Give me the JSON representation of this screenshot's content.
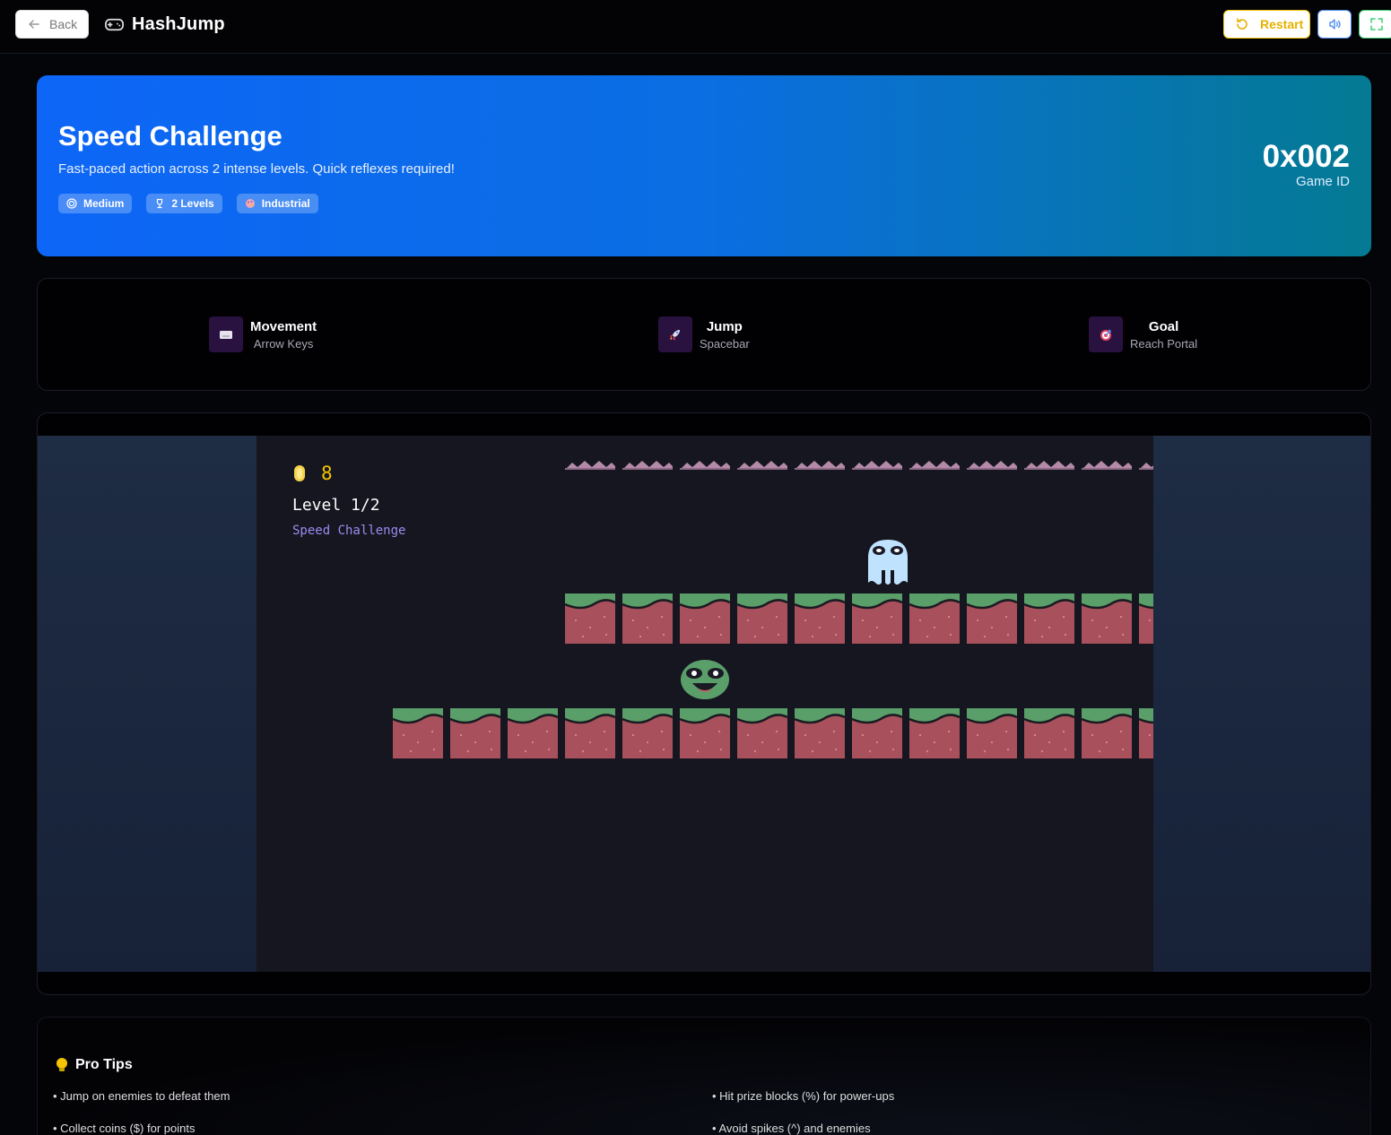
{
  "header": {
    "back_label": "Back",
    "brand": "HashJump",
    "restart_label": "Restart"
  },
  "hero": {
    "title": "Speed Challenge",
    "description": "Fast-paced action across 2 intense levels. Quick reflexes required!",
    "tags": [
      {
        "label": "Medium",
        "icon": "target-icon"
      },
      {
        "label": "2 Levels",
        "icon": "trophy-icon"
      },
      {
        "label": "Industrial",
        "icon": "palette-icon"
      }
    ],
    "game_id": "0x002",
    "game_id_label": "Game ID"
  },
  "controls": [
    {
      "title": "Movement",
      "sub": "Arrow Keys",
      "icon": "keyboard-icon"
    },
    {
      "title": "Jump",
      "sub": "Spacebar",
      "icon": "rocket-icon"
    },
    {
      "title": "Goal",
      "sub": "Reach Portal",
      "icon": "target-icon"
    }
  ],
  "game": {
    "coins": "8",
    "level": "Level 1/2",
    "subtitle": "Speed Challenge"
  },
  "tips": {
    "title": "Pro Tips",
    "items": [
      "• Jump on enemies to defeat them",
      "• Hit prize blocks (%) for power-ups",
      "• Collect coins ($) for points",
      "• Avoid spikes (^) and enemies"
    ]
  },
  "colors": {
    "accent_yellow": "#f6c400",
    "hero_start": "#0d66f7",
    "hero_end": "#047a93",
    "grass": "#5a9e6a",
    "dirt": "#a8505c",
    "spike": "#b48aa8"
  }
}
